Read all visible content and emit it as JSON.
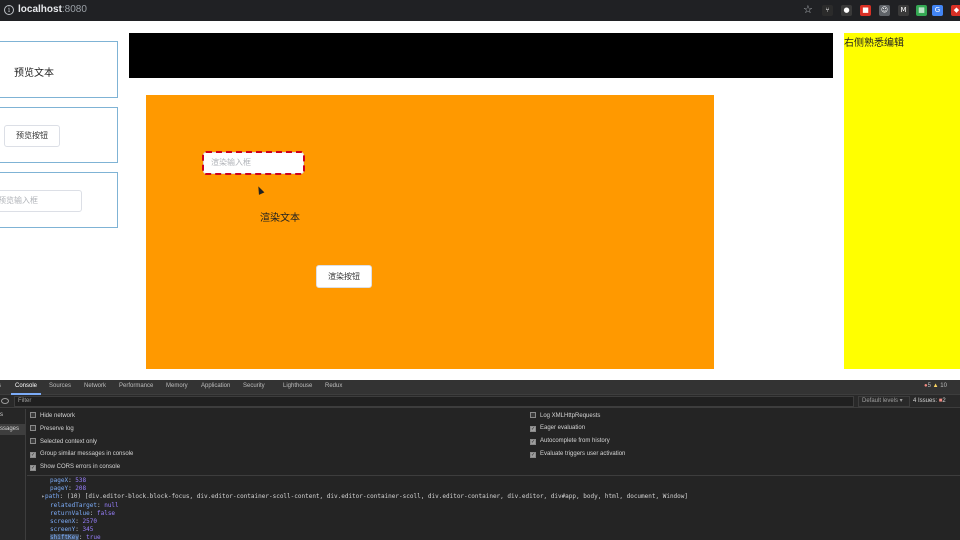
{
  "browser": {
    "url_host": "localhost",
    "url_port": ":8080",
    "extensions": [
      {
        "name": "ext-fork-icon",
        "glyph": "⑂",
        "color": "#2b2b2b"
      },
      {
        "name": "ext-circle-icon",
        "glyph": "●",
        "color": "#3a3a3a"
      },
      {
        "name": "ext-red-icon",
        "glyph": "■",
        "color": "#d93025"
      },
      {
        "name": "ext-person-icon",
        "glyph": "☺",
        "color": "#5f6368"
      },
      {
        "name": "ext-m-icon",
        "glyph": "M",
        "color": "#3a3a3a"
      },
      {
        "name": "ext-grid-icon",
        "glyph": "▦",
        "color": "#34a853"
      },
      {
        "name": "ext-translate-icon",
        "glyph": "G",
        "color": "#4285f4"
      },
      {
        "name": "ext-shield-icon",
        "glyph": "◆",
        "color": "#d93025"
      },
      {
        "name": "ext-v-icon",
        "glyph": "V",
        "color": "#202124"
      }
    ]
  },
  "left_panel": {
    "preview_text": "预览文本",
    "preview_button": "预览按钮",
    "preview_input_placeholder": "预览输入框"
  },
  "canvas": {
    "input_placeholder": "渲染输入框",
    "text": "渲染文本",
    "button": "渲染按钮"
  },
  "right_panel": {
    "title": "右侧熟悉编辑"
  },
  "devtools": {
    "tabs": [
      "s",
      "Console",
      "Sources",
      "Network",
      "Performance",
      "Memory",
      "Application",
      "Security",
      "Lighthouse",
      "Redux"
    ],
    "active_tab": "Console",
    "error_count": "5",
    "warning_count": "10",
    "filter_placeholder": "Filter",
    "default_levels": "Default levels ▾",
    "issues": "4 Issues:",
    "issues_count": "2",
    "sidebar": [
      "s",
      "ssages"
    ],
    "settings_left": [
      {
        "label": "Hide network",
        "checked": false
      },
      {
        "label": "Preserve log",
        "checked": false
      },
      {
        "label": "Selected context only",
        "checked": false
      },
      {
        "label": "Group similar messages in console",
        "checked": true
      },
      {
        "label": "Show CORS errors in console",
        "checked": true
      }
    ],
    "settings_right": [
      {
        "label": "Log XMLHttpRequests",
        "checked": false
      },
      {
        "label": "Eager evaluation",
        "checked": true
      },
      {
        "label": "Autocomplete from history",
        "checked": true
      },
      {
        "label": "Evaluate triggers user activation",
        "checked": true
      }
    ],
    "console_lines": [
      {
        "key": "pageX",
        "value": "538",
        "vtype": "num"
      },
      {
        "key": "pageY",
        "value": "208",
        "vtype": "num"
      },
      {
        "key": "path",
        "value": "(10) [div.editor-block.block-focus, div.editor-container-scoll-content, div.editor-container-scoll, div.editor-container, div.editor, div#app, body, html, document, Window]",
        "vtype": "plain",
        "expander": "▸"
      },
      {
        "key": "relatedTarget",
        "value": "null",
        "vtype": "kw"
      },
      {
        "key": "returnValue",
        "value": "false",
        "vtype": "kw"
      },
      {
        "key": "screenX",
        "value": "2570",
        "vtype": "num"
      },
      {
        "key": "screenY",
        "value": "345",
        "vtype": "num"
      },
      {
        "key": "shiftKey",
        "value": "true",
        "vtype": "kw",
        "highlight": true
      }
    ]
  }
}
